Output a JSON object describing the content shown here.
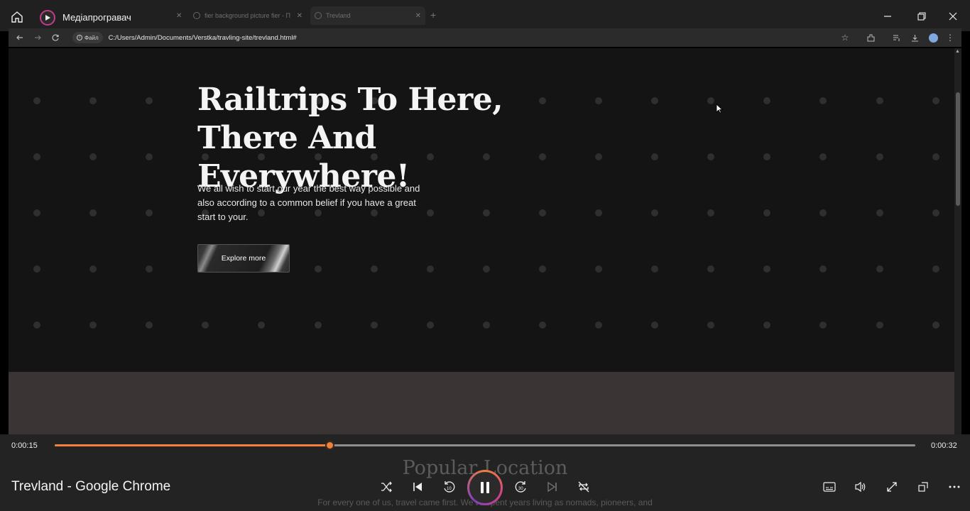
{
  "player": {
    "app_title": "Медіапрогравач",
    "now_playing": "Trevland - Google Chrome",
    "elapsed": "0:00:15",
    "duration": "0:00:32",
    "progress": 0.319,
    "accent_color": "#f0803c",
    "icons": [
      "home-icon",
      "shuffle-icon",
      "previous-icon",
      "rewind-10-icon",
      "pause-icon",
      "forward-30-icon",
      "next-icon",
      "repeat-off-icon",
      "subtitles-icon",
      "volume-icon",
      "fullscreen-icon",
      "mini-player-icon",
      "more-icon"
    ]
  },
  "browser": {
    "tabs": [
      {
        "label": "fier background picture fier - П"
      },
      {
        "label": "Trevland"
      }
    ],
    "site_chip": "Файл",
    "url": "C:/Users/Admin/Documents/Verstka/travling-site/trevland.html#"
  },
  "page": {
    "hero": {
      "title_line1": "Railtrips To Here,",
      "title_line2": "There And Everywhere!",
      "text": "We all wish to start our year the best way possible and also according to a common belief if you have a great start to your.",
      "cta": "Explore more"
    },
    "popular": {
      "heading": "Popular Location",
      "text": "For every one of us, travel came first. We've spent years living as nomads, pioneers, and"
    }
  }
}
